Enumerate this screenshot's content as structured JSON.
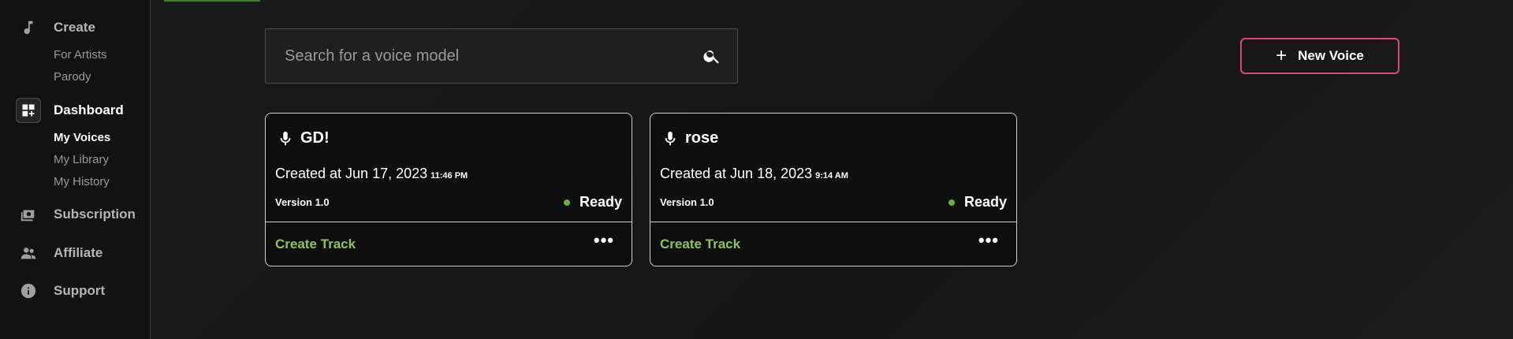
{
  "sidebar": {
    "create_label": "Create",
    "create_sub": [
      "For Artists",
      "Parody"
    ],
    "dashboard_label": "Dashboard",
    "dashboard_sub": [
      "My Voices",
      "My Library",
      "My History"
    ],
    "subscription_label": "Subscription",
    "affiliate_label": "Affiliate",
    "support_label": "Support"
  },
  "search": {
    "placeholder": "Search for a voice model",
    "value": ""
  },
  "new_voice": {
    "icon": "+",
    "label": "New Voice"
  },
  "voices": [
    {
      "name": "GD!",
      "created_prefix": "Created at Jun 17, 2023",
      "created_time": "11:46 PM",
      "version": "Version 1.0",
      "status": "Ready",
      "action_label": "Create Track",
      "more_label": "•••"
    },
    {
      "name": "rose",
      "created_prefix": "Created at Jun 18, 2023",
      "created_time": "9:14 AM",
      "version": "Version 1.0",
      "status": "Ready",
      "action_label": "Create Track",
      "more_label": "•••"
    }
  ],
  "colors": {
    "accent_green": "#8fc45a",
    "status_green": "#6aae3c",
    "new_voice_border": "#d94a72"
  },
  "icons": {
    "create": "music-note-icon",
    "dashboard": "dashboard-add-icon",
    "subscription": "money-icon",
    "affiliate": "people-icon",
    "support": "info-icon",
    "search": "search-icon",
    "voice": "mic-icon",
    "more": "more-horizontal-icon"
  }
}
